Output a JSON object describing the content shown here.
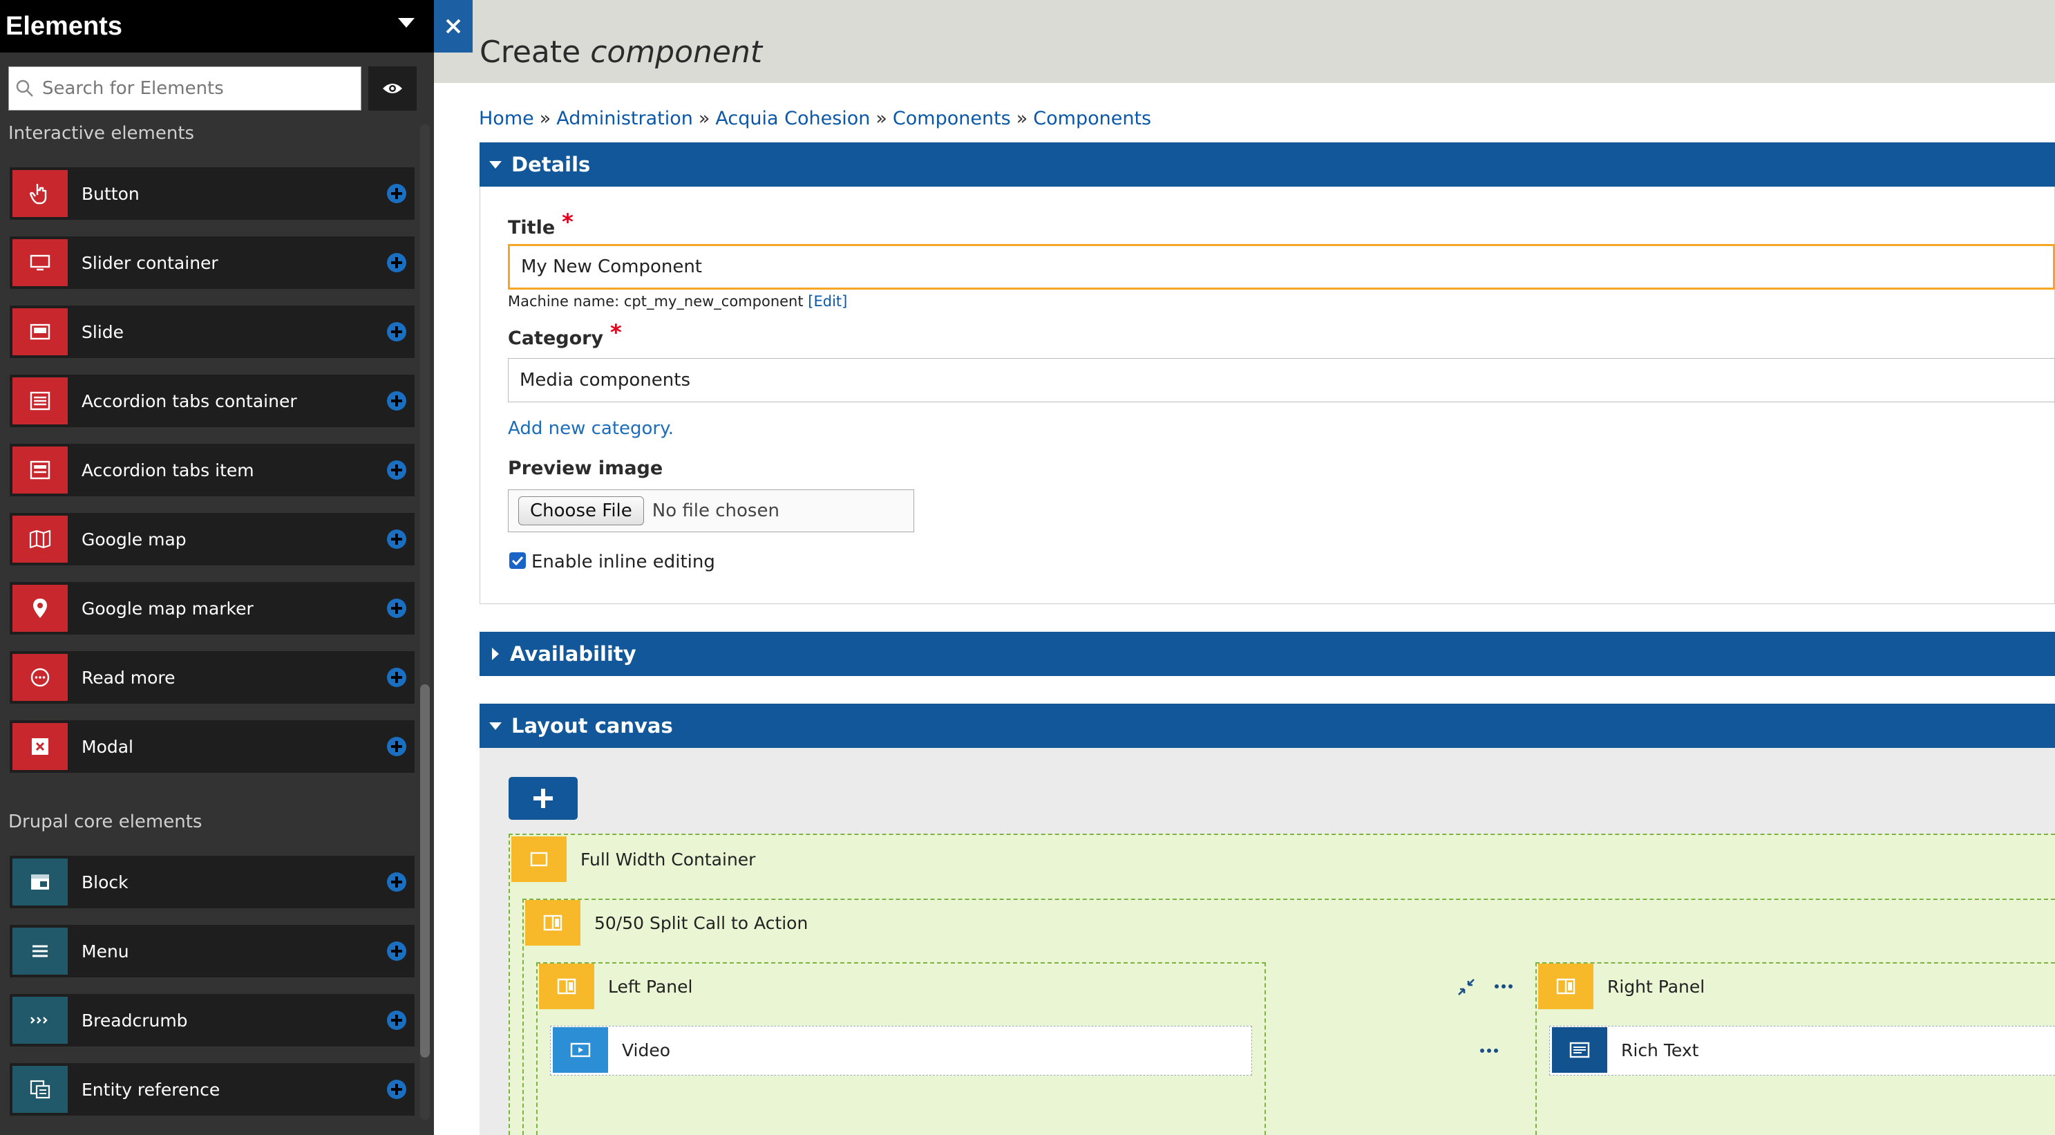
{
  "sidebar": {
    "title": "Elements",
    "search_placeholder": "Search for Elements",
    "section_interactive": "Interactive elements",
    "section_drupal": "Drupal core elements",
    "interactive_items": [
      {
        "label": "Button",
        "icon": "pointer-hand-icon"
      },
      {
        "label": "Slider container",
        "icon": "monitor-icon"
      },
      {
        "label": "Slide",
        "icon": "slide-icon"
      },
      {
        "label": "Accordion tabs container",
        "icon": "accordion-icon"
      },
      {
        "label": "Accordion tabs item",
        "icon": "accordion-item-icon"
      },
      {
        "label": "Google map",
        "icon": "map-icon"
      },
      {
        "label": "Google map marker",
        "icon": "map-pin-icon"
      },
      {
        "label": "Read more",
        "icon": "ellipsis-circle-icon"
      },
      {
        "label": "Modal",
        "icon": "modal-icon"
      }
    ],
    "drupal_items": [
      {
        "label": "Block",
        "icon": "block-icon"
      },
      {
        "label": "Menu",
        "icon": "menu-icon"
      },
      {
        "label": "Breadcrumb",
        "icon": "breadcrumb-icon"
      },
      {
        "label": "Entity reference",
        "icon": "entity-reference-icon"
      }
    ]
  },
  "header": {
    "title_prefix": "Create",
    "title_emphasis": "component"
  },
  "breadcrumb": [
    "Home",
    "Administration",
    "Acquia Cohesion",
    "Components",
    "Components"
  ],
  "details": {
    "heading": "Details",
    "title_label": "Title",
    "title_value": "My New Component",
    "machine_name_prefix": "Machine name: cpt_my_new_component",
    "machine_name_edit": "[Edit]",
    "category_label": "Category",
    "category_value": "Media components",
    "add_category": "Add new category.",
    "preview_label": "Preview image",
    "choose_file": "Choose File",
    "no_file": "No file chosen",
    "inline_editing_label": "Enable inline editing",
    "inline_editing_checked": true
  },
  "availability": {
    "heading": "Availability"
  },
  "layout_canvas": {
    "heading": "Layout canvas",
    "items": {
      "full_width": "Full Width Container",
      "split": "50/50 Split Call to Action",
      "left_panel": "Left Panel",
      "right_panel": "Right Panel",
      "video": "Video",
      "rich_text": "Rich Text"
    }
  },
  "colors": {
    "sidebar_bg": "#333333",
    "brand_blue": "#115799",
    "icon_red": "#c8282d",
    "icon_teal": "#21586a",
    "canvas_green": "#eaf5d3",
    "component_orange": "#f7b92a"
  }
}
